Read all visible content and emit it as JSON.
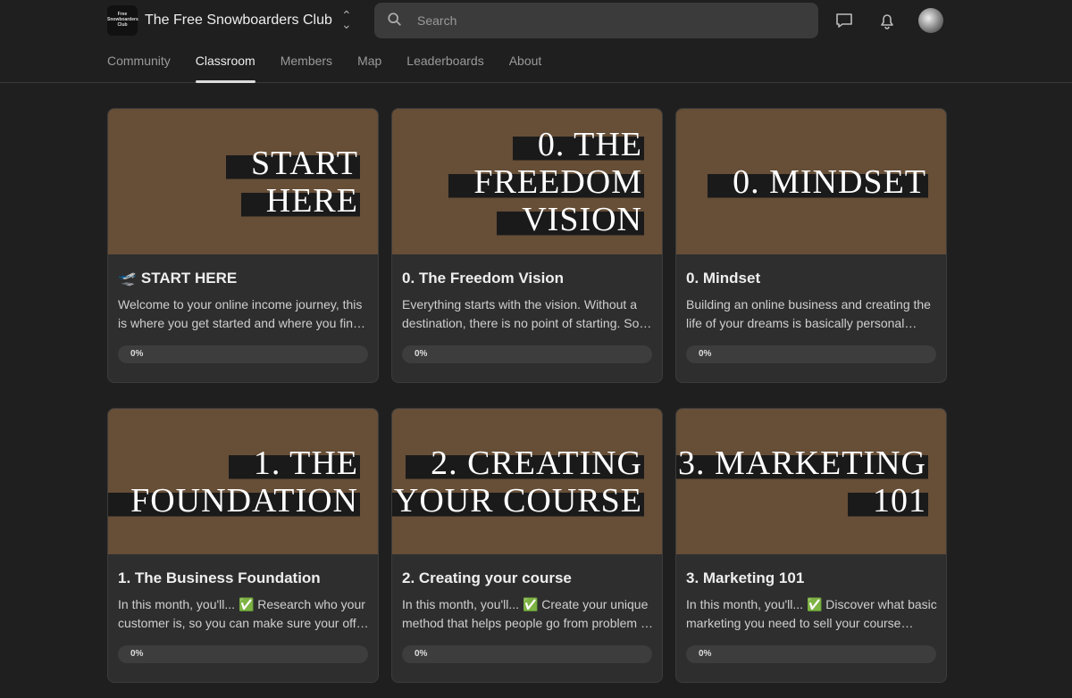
{
  "header": {
    "logo_text": "Free Snowboarders Club",
    "group_name": "The Free Snowboarders Club",
    "search_placeholder": "Search"
  },
  "tabs": [
    {
      "label": "Community"
    },
    {
      "label": "Classroom",
      "active": true
    },
    {
      "label": "Members"
    },
    {
      "label": "Map"
    },
    {
      "label": "Leaderboards"
    },
    {
      "label": "About"
    }
  ],
  "courses": [
    {
      "banner": [
        "START",
        "HERE"
      ],
      "title": "🛫 START HERE",
      "description": "Welcome to your online income journey, this is where you get started and where you find all the resources you need.",
      "progress_label": "0%",
      "progress": 0
    },
    {
      "banner": [
        "0. THE",
        "FREEDOM",
        "VISION"
      ],
      "title": "0. The Freedom Vision",
      "description": "Everything starts with the vision. Without a destination, there is no point of starting. So let's define it.",
      "progress_label": "0%",
      "progress": 0
    },
    {
      "banner": [
        "0. MINDSET"
      ],
      "title": "0. Mindset",
      "description": "Building an online business and creating the life of your dreams is basically personal growth.",
      "progress_label": "0%",
      "progress": 0
    },
    {
      "banner": [
        "1. THE",
        "FOUNDATION"
      ],
      "title": "1. The Business Foundation",
      "description": "In this month, you'll... ✅ Research who your customer is, so you can make sure your offer fits.",
      "progress_label": "0%",
      "progress": 0
    },
    {
      "banner": [
        "2. CREATING",
        "YOUR COURSE"
      ],
      "title": "2. Creating your course",
      "description": "In this month, you'll... ✅ Create your unique method that helps people go from problem to result.",
      "progress_label": "0%",
      "progress": 0
    },
    {
      "banner": [
        "3. MARKETING",
        "101"
      ],
      "title": "3. Marketing 101",
      "description": "In this month, you'll... ✅ Discover what basic marketing you need to sell your course seamlessly.",
      "progress_label": "0%",
      "progress": 0
    }
  ]
}
